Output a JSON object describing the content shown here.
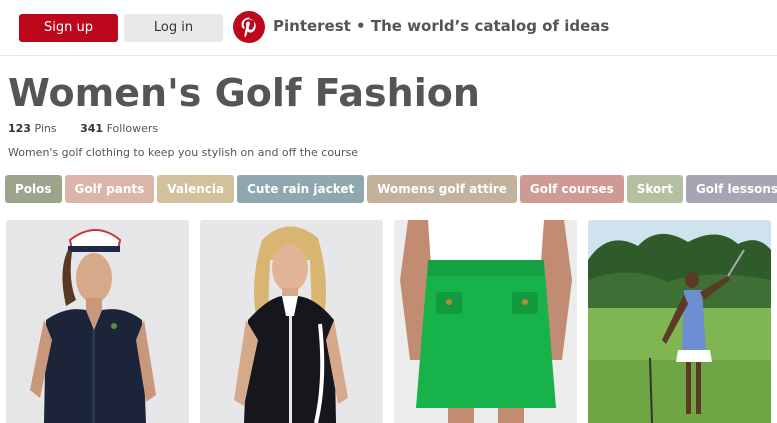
{
  "header": {
    "signup_label": "Sign up",
    "login_label": "Log in",
    "logo_icon": "pinterest-logo-icon",
    "tagline": "Pinterest • The world’s catalog of ideas"
  },
  "board": {
    "title": "Women's Golf Fashion",
    "pins_count": "123",
    "pins_label": "Pins",
    "followers_count": "341",
    "followers_label": "Followers",
    "description": "Women's golf clothing to keep you stylish on and off the course"
  },
  "tags": [
    {
      "label": "Polos",
      "color": "#9ba58c"
    },
    {
      "label": "Golf pants",
      "color": "#dbb5a8"
    },
    {
      "label": "Valencia",
      "color": "#d3c09c"
    },
    {
      "label": "Cute rain jacket",
      "color": "#8fa8b0"
    },
    {
      "label": "Womens golf attire",
      "color": "#c2b29d"
    },
    {
      "label": "Golf courses",
      "color": "#cf9a94"
    },
    {
      "label": "Skort",
      "color": "#b5c0a0"
    },
    {
      "label": "Golf lessons",
      "color": "#a9a4b4"
    }
  ],
  "pins": [
    {
      "name": "pin-navy-polo-visor"
    },
    {
      "name": "pin-black-zip-dress"
    },
    {
      "name": "pin-green-skort"
    },
    {
      "name": "pin-golfer-on-course"
    }
  ],
  "colors": {
    "brand_red": "#bd081c",
    "login_gray": "#e9e9e9",
    "text_gray": "#555555"
  }
}
